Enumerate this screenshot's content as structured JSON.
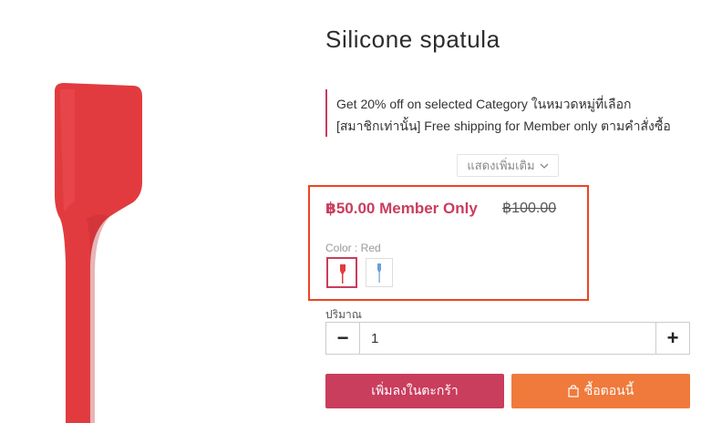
{
  "product": {
    "title": "Silicone spatula",
    "image_icon": "red-spatula-image",
    "promotions": [
      "Get 20% off on selected Category ในหมวดหมู่ที่เลือก",
      "[สมาชิกเท่านั้น] Free shipping for Member only ตามคำสั่งซื้อ"
    ],
    "show_more_label": "แสดงเพิ่มเติม",
    "price": "฿50.00 Member Only",
    "old_price": "฿100.00",
    "color_label": "Color : Red",
    "swatches": [
      {
        "name": "Red",
        "selected": true,
        "color": "#e23b3f"
      },
      {
        "name": "Blue",
        "selected": false,
        "color": "#6aa0d6"
      }
    ]
  },
  "quantity": {
    "label": "ปริมาณ",
    "value": "1",
    "minus_label": "−",
    "plus_label": "+"
  },
  "actions": {
    "add_to_cart_label": "เพิ่มลงในตะกร้า",
    "buy_now_label": "ซื้อตอนนี้"
  },
  "colors": {
    "accent": "#c93d5d",
    "buy_button": "#ef7a3c",
    "highlight_border": "#ee4423",
    "spatula_red": "#e23b3f"
  }
}
